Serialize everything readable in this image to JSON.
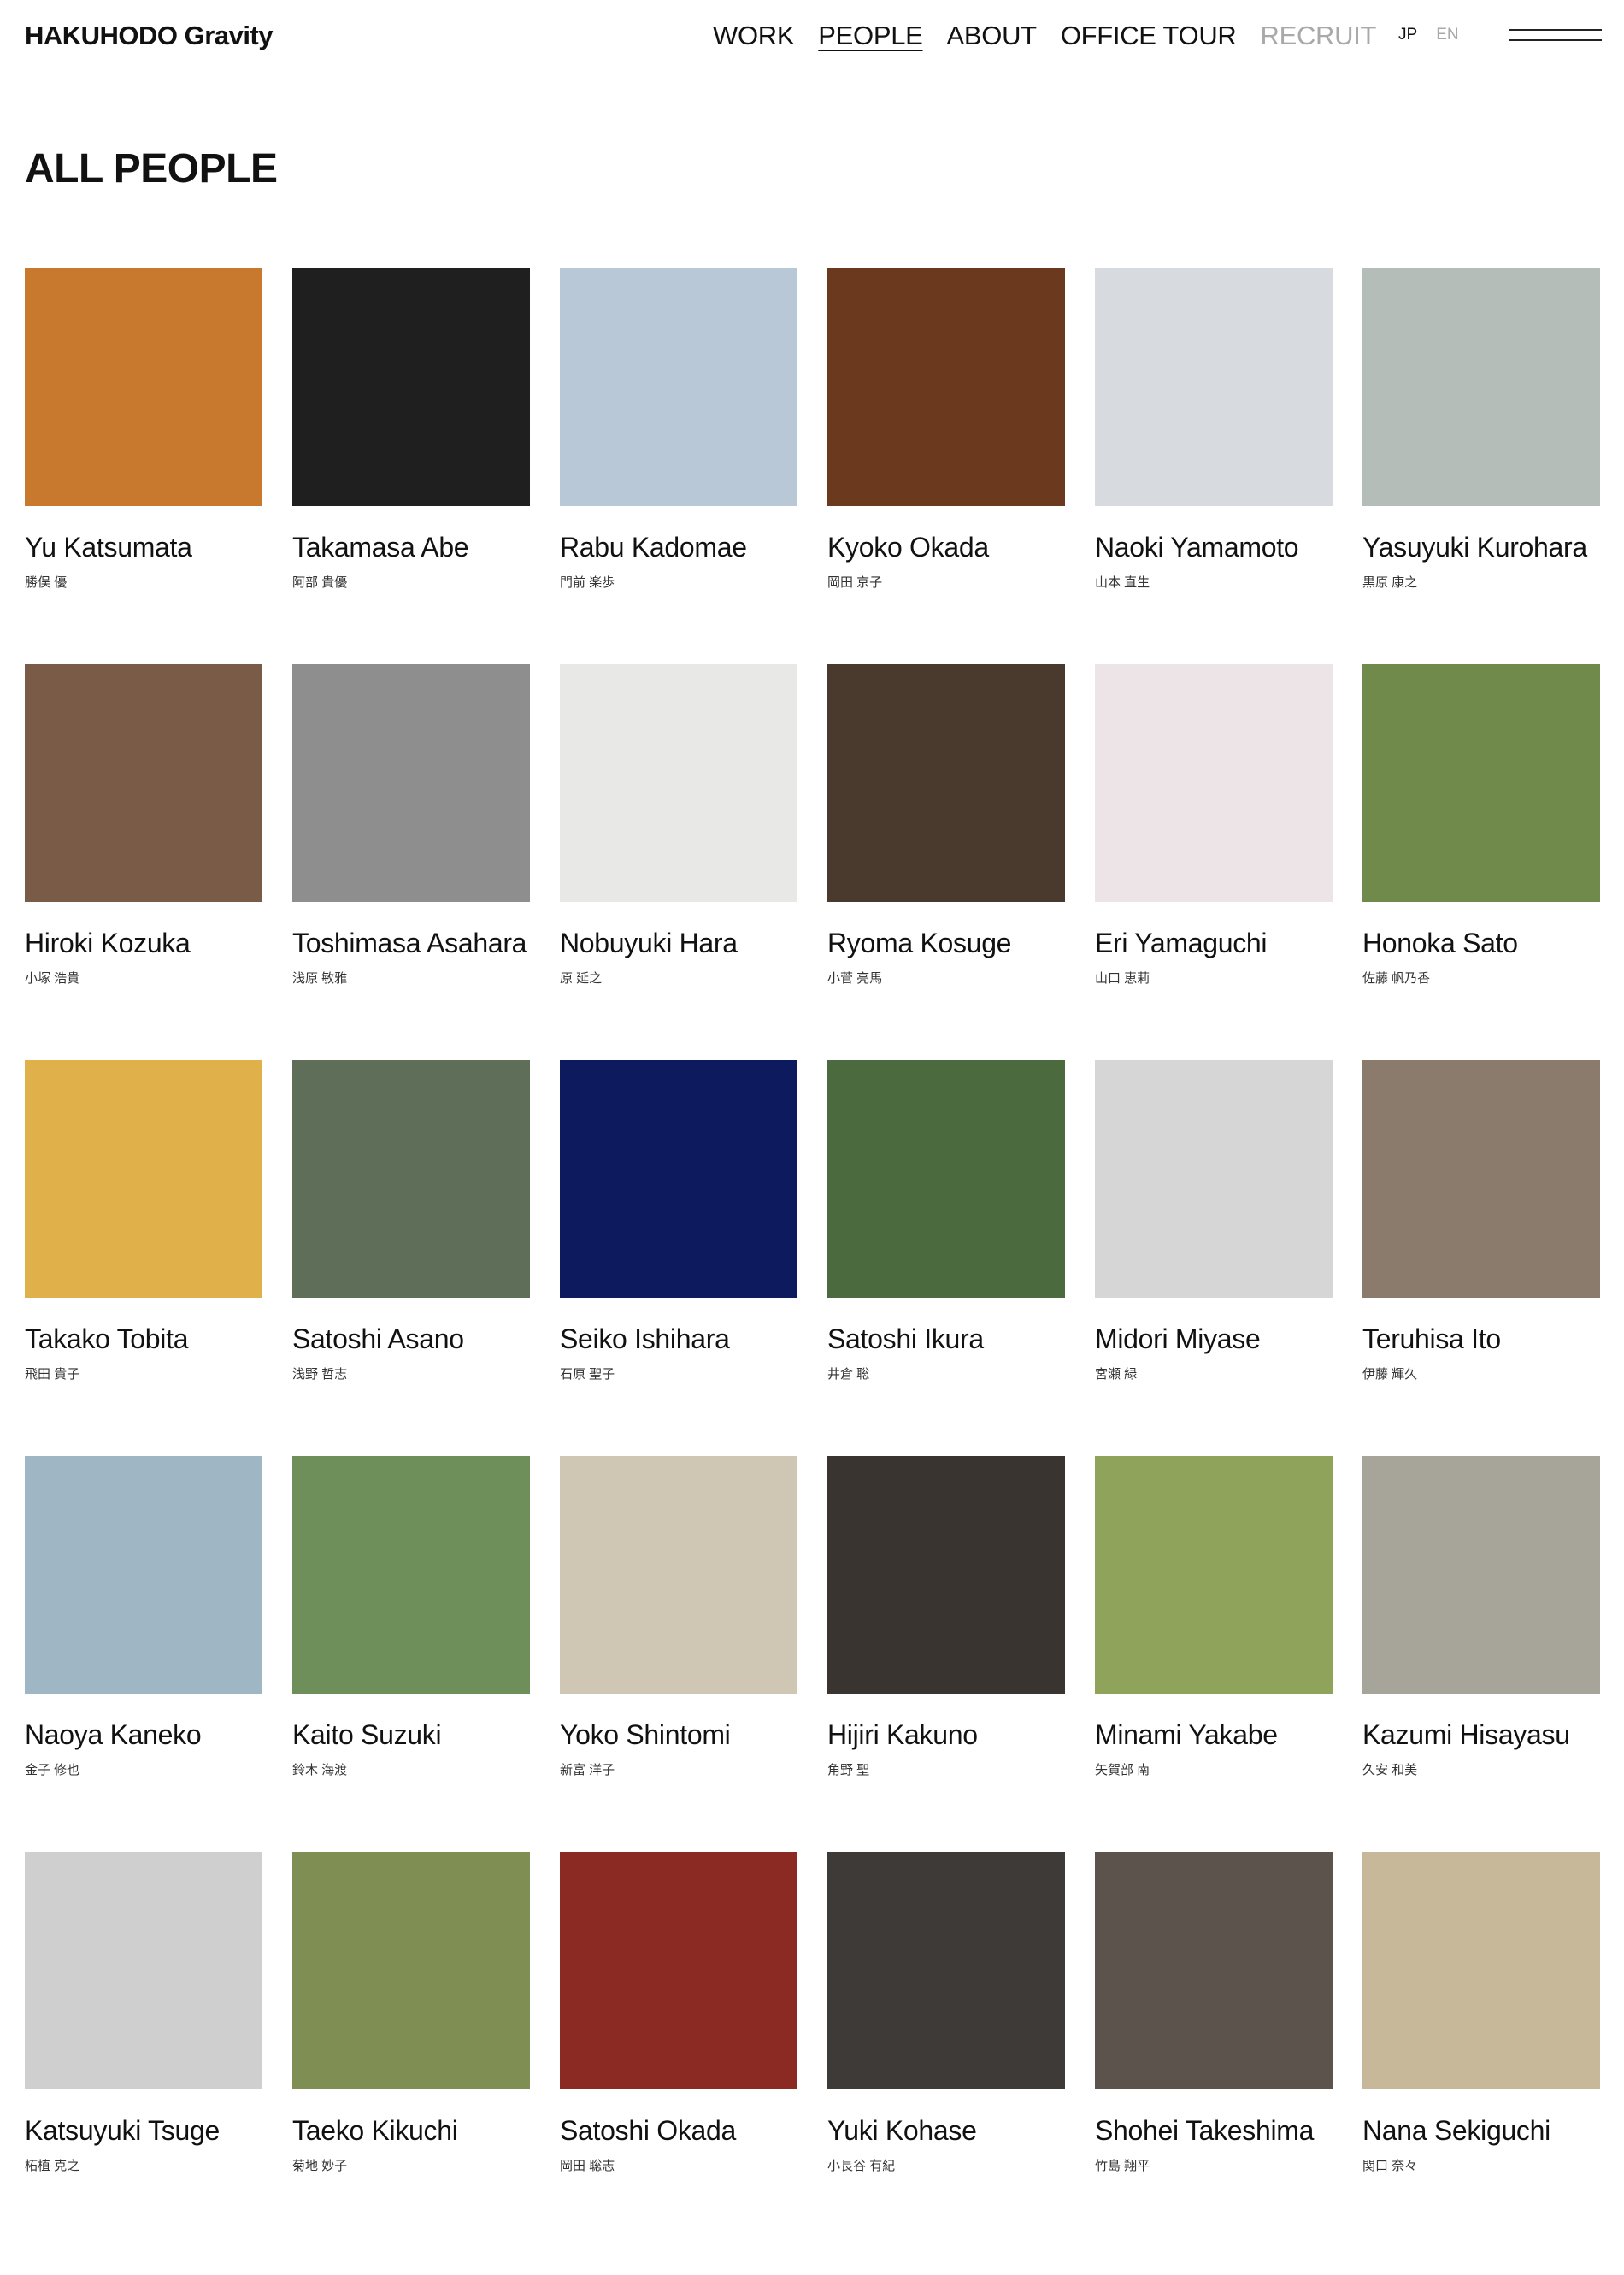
{
  "header": {
    "logo": "HAKUHODO Gravity",
    "nav": [
      {
        "label": "WORK",
        "state": "normal"
      },
      {
        "label": "PEOPLE",
        "state": "active"
      },
      {
        "label": "ABOUT",
        "state": "normal"
      },
      {
        "label": "OFFICE TOUR",
        "state": "normal"
      },
      {
        "label": "RECRUIT",
        "state": "muted"
      }
    ],
    "lang": {
      "jp": "JP",
      "en": "EN"
    }
  },
  "page_title": "ALL PEOPLE",
  "people": [
    {
      "name": "Yu Katsumata",
      "jp": "勝俣 優",
      "icon": "highball-glass-photo",
      "bg": "#c9792e"
    },
    {
      "name": "Takamasa Abe",
      "jp": "阿部 貴優",
      "icon": "memoji-avatar",
      "bg": "#1f1f1f"
    },
    {
      "name": "Rabu Kadomae",
      "jp": "門前 楽歩",
      "icon": "nail-art-photo",
      "bg": "#b9c8d6"
    },
    {
      "name": "Kyoko Okada",
      "jp": "岡田 京子",
      "icon": "beer-glasses-photo",
      "bg": "#6b3a1e"
    },
    {
      "name": "Naoki Yamamoto",
      "jp": "山本 直生",
      "icon": "portrait-photo",
      "bg": "#d7dadf"
    },
    {
      "name": "Yasuyuki Kurohara",
      "jp": "黒原 康之",
      "icon": "terrace-table-photo",
      "bg": "#b5bdb8"
    },
    {
      "name": "Hiroki Kozuka",
      "jp": "小塚 浩貴",
      "icon": "selfie-photo",
      "bg": "#7a5b48"
    },
    {
      "name": "Toshimasa Asahara",
      "jp": "浅原 敏雅",
      "icon": "bw-portrait-photo",
      "bg": "#8e8e8e"
    },
    {
      "name": "Nobuyuki Hara",
      "jp": "原 延之",
      "icon": "sketch-portrait",
      "bg": "#e8e8e6"
    },
    {
      "name": "Ryoma Kosuge",
      "jp": "小菅 亮馬",
      "icon": "bottles-photo",
      "bg": "#4a3a2e"
    },
    {
      "name": "Eri Yamaguchi",
      "jp": "山口 恵莉",
      "icon": "gallery-photo",
      "bg": "#ece4e6"
    },
    {
      "name": "Honoka Sato",
      "jp": "佐藤 帆乃香",
      "icon": "yoga-mat-photo",
      "bg": "#6f8a4a"
    },
    {
      "name": "Takako Tobita",
      "jp": "飛田 貴子",
      "icon": "rice-dish-photo",
      "bg": "#e0b04a"
    },
    {
      "name": "Satoshi Asano",
      "jp": "浅野 哲志",
      "icon": "museum-photo",
      "bg": "#5f6e58"
    },
    {
      "name": "Seiko Ishihara",
      "jp": "石原 聖子",
      "icon": "pixel-art-photo",
      "bg": "#0d1a5e"
    },
    {
      "name": "Satoshi Ikura",
      "jp": "井倉 聡",
      "icon": "tennis-court-photo",
      "bg": "#4b6a3e"
    },
    {
      "name": "Midori Miyase",
      "jp": "宮瀬 緑",
      "icon": "silver-ring-photo",
      "bg": "#d6d6d6"
    },
    {
      "name": "Teruhisa Ito",
      "jp": "伊藤 輝久",
      "icon": "scooter-photo",
      "bg": "#8a7b6c"
    },
    {
      "name": "Naoya Kaneko",
      "jp": "金子 修也",
      "icon": "id-photos",
      "bg": "#9fb7c4"
    },
    {
      "name": "Kaito Suzuki",
      "jp": "鈴木 海渡",
      "icon": "forest-photo",
      "bg": "#6e8f5a"
    },
    {
      "name": "Yoko Shintomi",
      "jp": "新富 洋子",
      "icon": "beach-shadow-photo",
      "bg": "#cfc6b4"
    },
    {
      "name": "Hijiri Kakuno",
      "jp": "角野 聖",
      "icon": "night-wall-photo",
      "bg": "#3a3430"
    },
    {
      "name": "Minami Yakabe",
      "jp": "矢賀部 南",
      "icon": "giraffe-photo",
      "bg": "#8fa35a"
    },
    {
      "name": "Kazumi Hisayasu",
      "jp": "久安 和美",
      "icon": "park-path-photo",
      "bg": "#a7a59a"
    },
    {
      "name": "Katsuyuki Tsuge",
      "jp": "柘植 克之",
      "icon": "polka-dots-photo",
      "bg": "#cfcfcf"
    },
    {
      "name": "Taeko Kikuchi",
      "jp": "菊地 妙子",
      "icon": "salads-grid-photo",
      "bg": "#7f8e52"
    },
    {
      "name": "Satoshi Okada",
      "jp": "岡田 聡志",
      "icon": "glass-cat-photo",
      "bg": "#8a2a22"
    },
    {
      "name": "Yuki Kohase",
      "jp": "小長谷 有紀",
      "icon": "mirror-selfie-photo",
      "bg": "#3d3a38"
    },
    {
      "name": "Shohei Takeshima",
      "jp": "竹島 翔平",
      "icon": "bookshelf-selfie-photo",
      "bg": "#5c544c"
    },
    {
      "name": "Nana Sekiguchi",
      "jp": "関口 奈々",
      "icon": "sake-bottle-photo",
      "bg": "#c7b89a"
    }
  ]
}
